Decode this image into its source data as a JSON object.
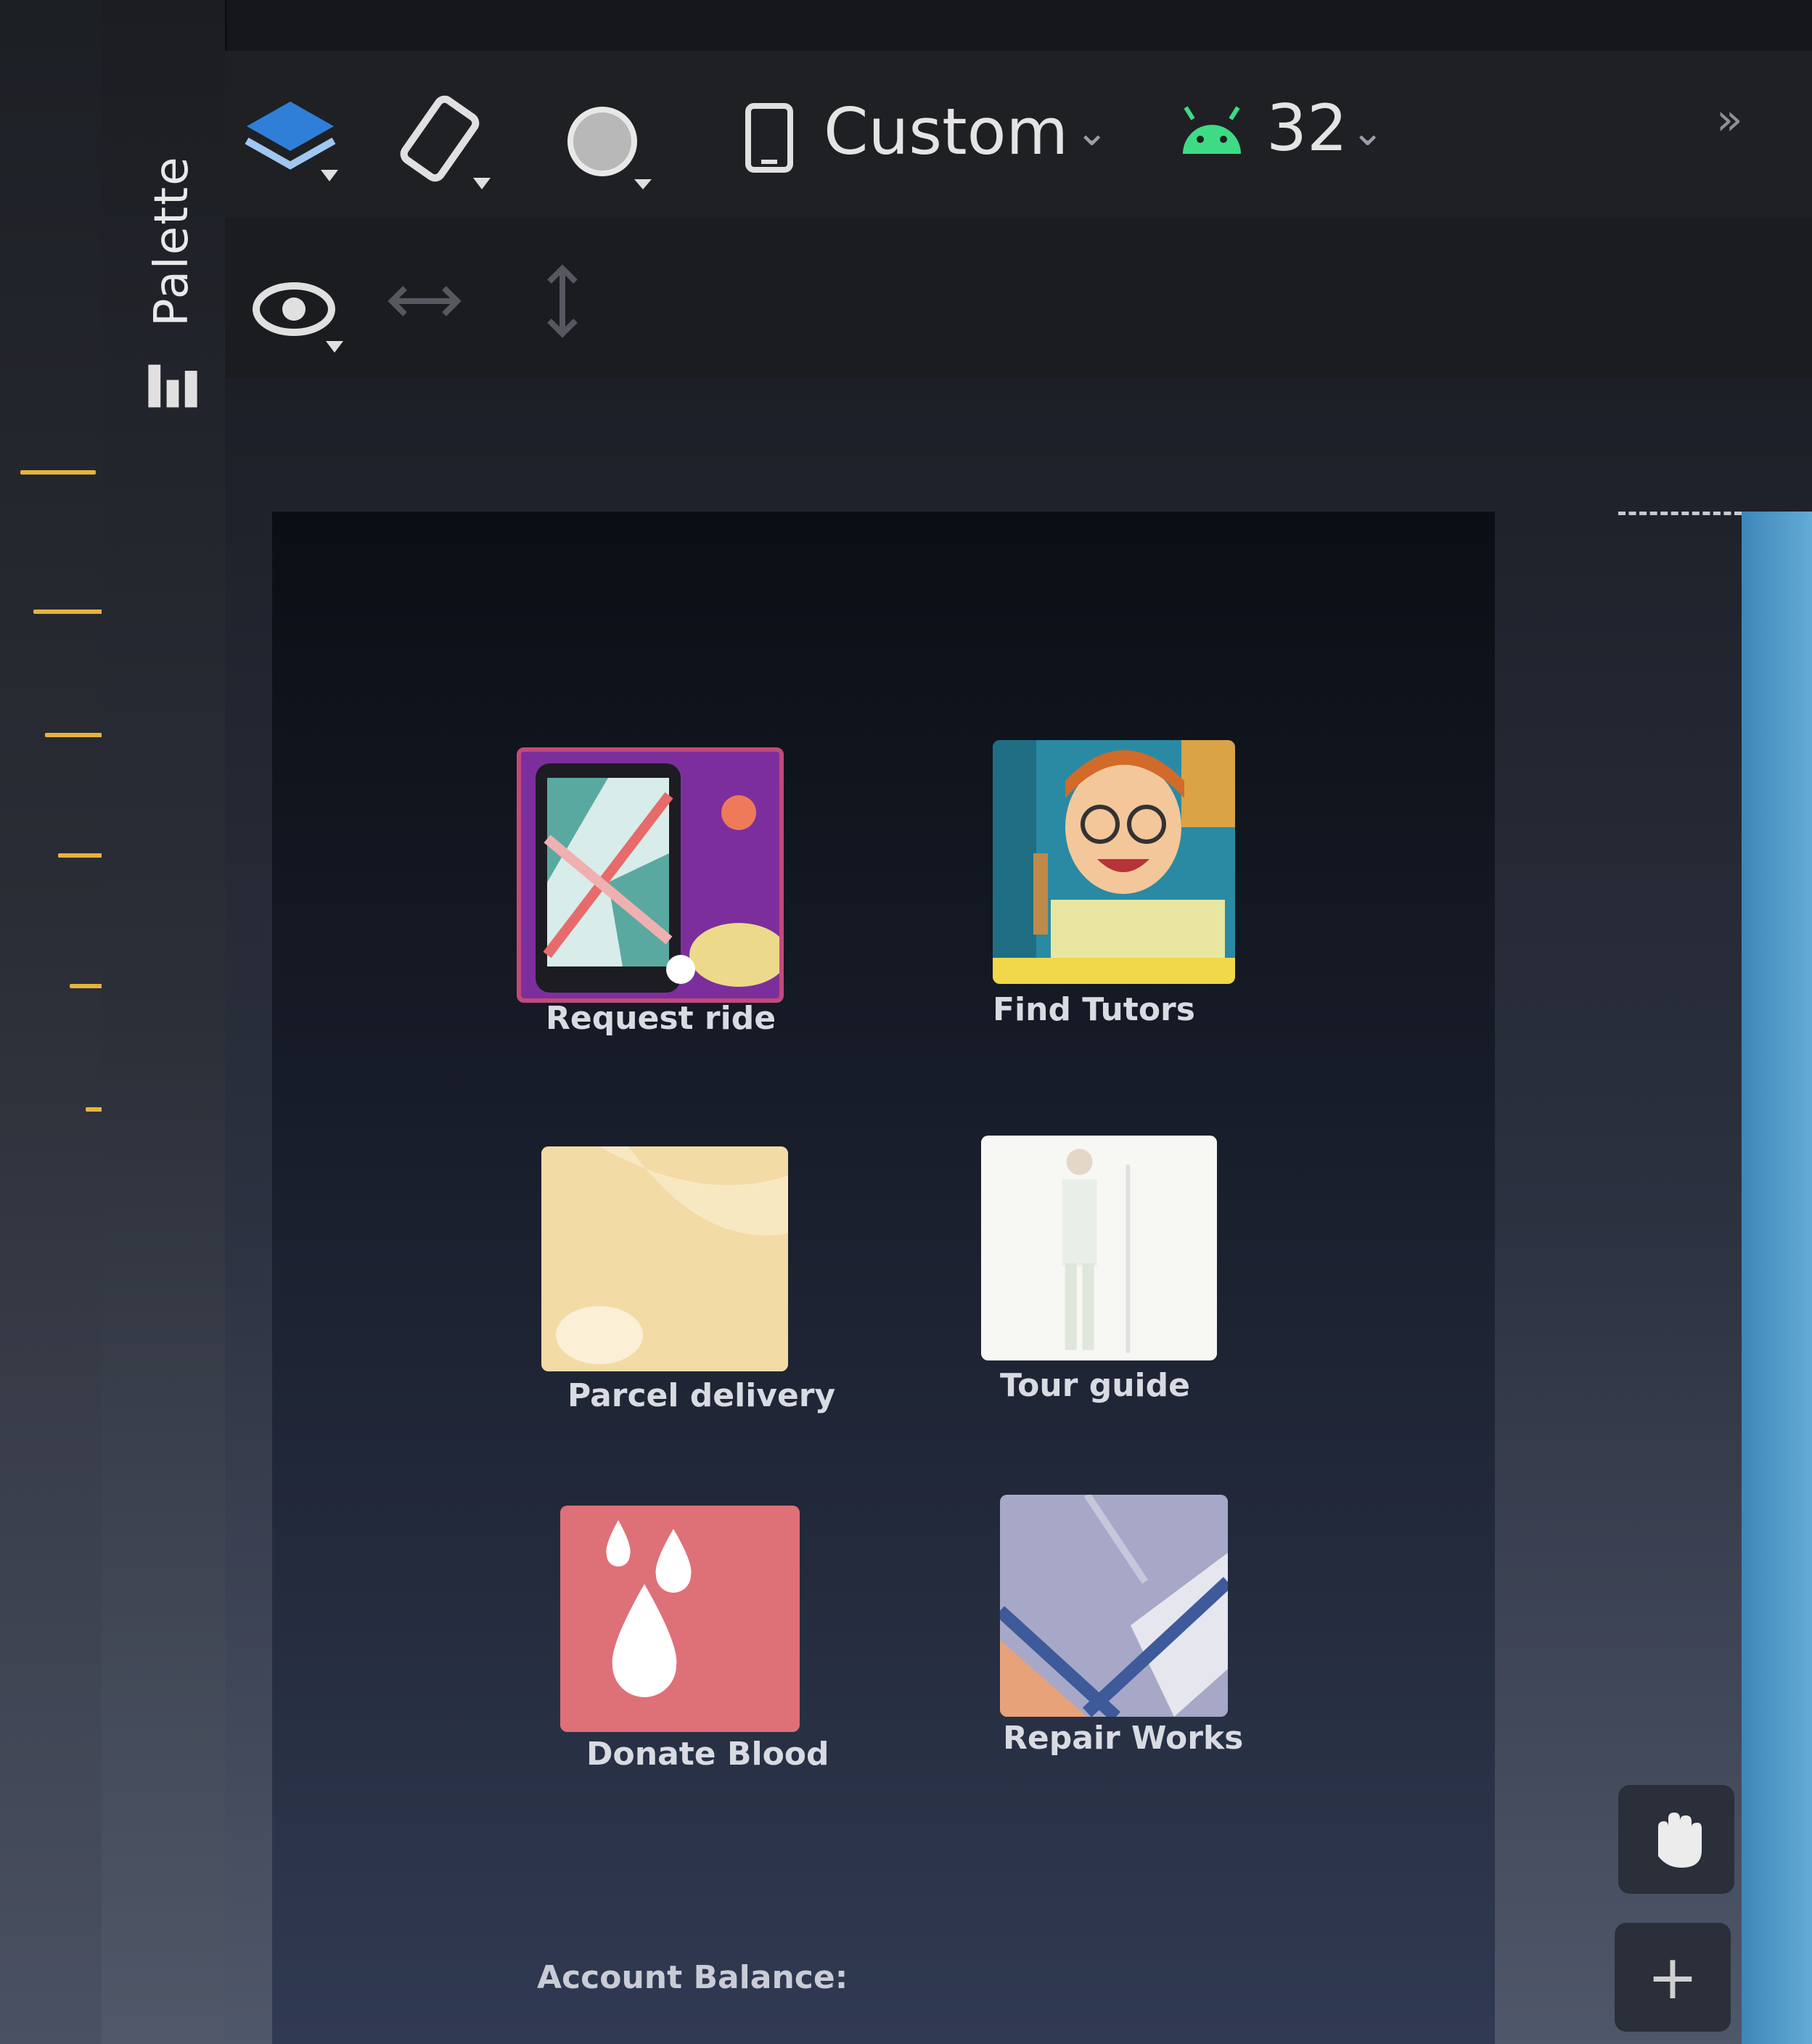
{
  "palette": {
    "label": "Palette"
  },
  "toolbar": {
    "device_label": "Custom",
    "api_level": "32",
    "overflow": "»",
    "icons": [
      "layers-icon",
      "rotate-icon",
      "theme-icon",
      "phone-icon",
      "android-icon",
      "eye-icon",
      "horizontal-resize-icon",
      "vertical-resize-icon",
      "wrench-icon"
    ]
  },
  "tiles": [
    {
      "label": "Request ride"
    },
    {
      "label": "Find Tutors"
    },
    {
      "label": "Parcel delivery"
    },
    {
      "label": "Tour guide"
    },
    {
      "label": "Donate Blood"
    },
    {
      "label": "Repair Works"
    }
  ],
  "footer": {
    "account_balance": "Account Balance:"
  },
  "canvas_controls": {
    "pan_icon": "hand-icon",
    "zoom_in": "+"
  },
  "colors": {
    "accent_yellow": "#e6b43c",
    "android_green": "#3ddc84",
    "layers_blue": "#2f7fd8",
    "preview_bg": "#161b27"
  }
}
